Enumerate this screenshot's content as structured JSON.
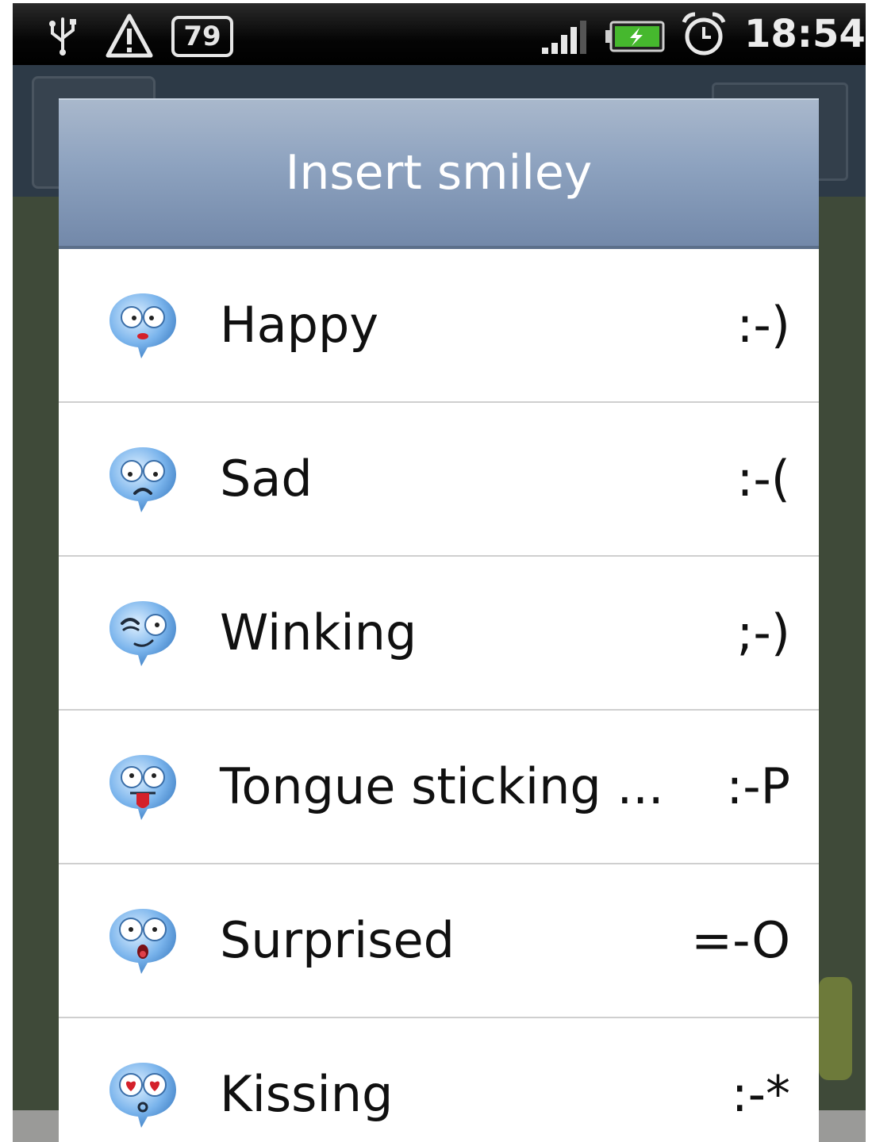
{
  "status_bar": {
    "notification_count": "79",
    "time": "18:54",
    "icons": [
      "usb-icon",
      "warning-icon",
      "signal-icon",
      "battery-charging-icon",
      "alarm-clock-icon"
    ]
  },
  "dialog": {
    "title": "Insert smiley",
    "header_color": "#8da2bf",
    "items": [
      {
        "name": "Happy",
        "code": ":-)",
        "icon": "happy-smiley-icon"
      },
      {
        "name": "Sad",
        "code": ":-(",
        "icon": "sad-smiley-icon"
      },
      {
        "name": "Winking",
        "code": ";-)",
        "icon": "winking-smiley-icon"
      },
      {
        "name": "Tongue sticking ...",
        "code": ":-P",
        "icon": "tongue-smiley-icon"
      },
      {
        "name": "Surprised",
        "code": "=-O",
        "icon": "surprised-smiley-icon"
      },
      {
        "name": "Kissing",
        "code": ":-*",
        "icon": "kissing-smiley-icon"
      }
    ]
  }
}
